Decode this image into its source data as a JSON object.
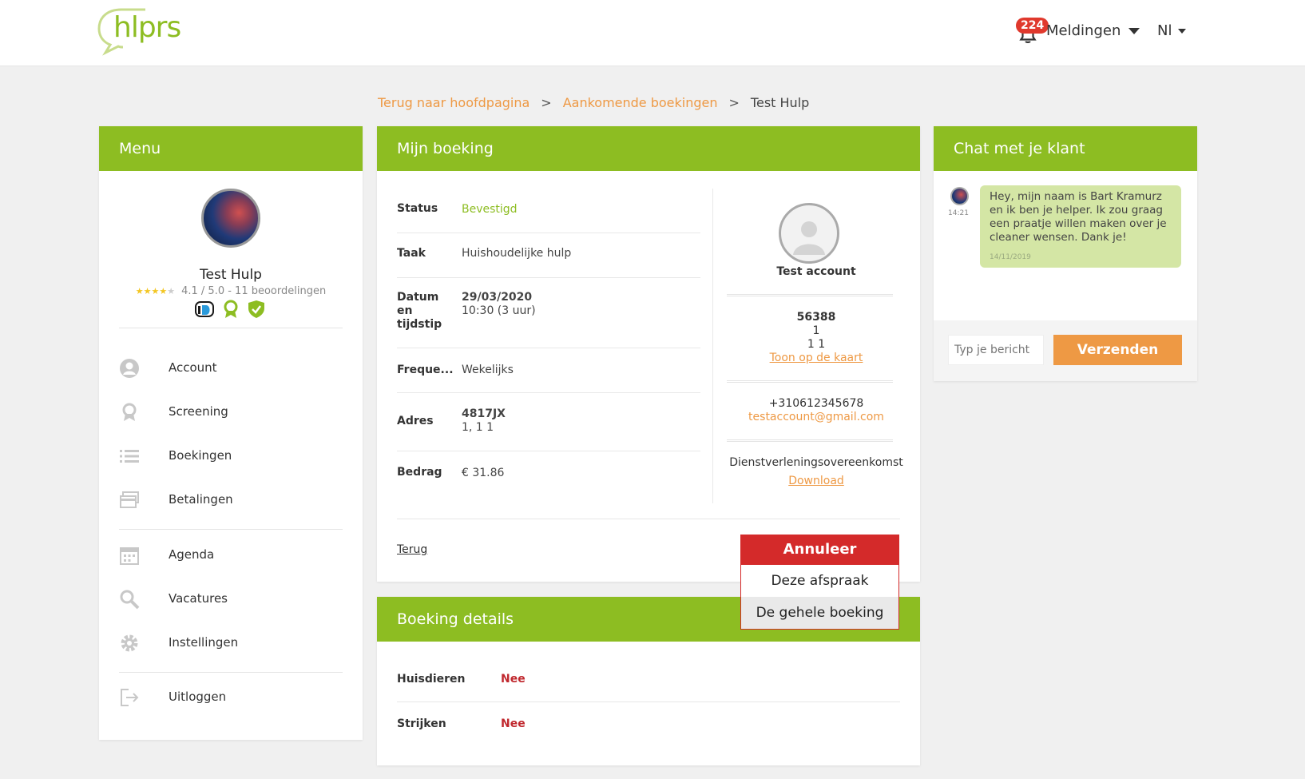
{
  "header": {
    "logo_text": "hlprs",
    "notifications": {
      "count": "224",
      "label": "Meldingen"
    },
    "language": "Nl"
  },
  "breadcrumb": {
    "home": "Terug naar hoofdpagina",
    "upcoming": "Aankomende boekingen",
    "current": "Test Hulp",
    "separator": ">"
  },
  "menu": {
    "title": "Menu",
    "profile": {
      "name": "Test Hulp",
      "rating_text": "4.1 / 5.0 - 11 beoordelingen",
      "stars": 4.1
    },
    "items": [
      {
        "label": "Account",
        "icon": "user-circle-icon"
      },
      {
        "label": "Screening",
        "icon": "award-icon"
      },
      {
        "label": "Boekingen",
        "icon": "list-icon"
      },
      {
        "label": "Betalingen",
        "icon": "credit-card-icon"
      },
      {
        "label": "Agenda",
        "icon": "calendar-icon"
      },
      {
        "label": "Vacatures",
        "icon": "search-icon"
      },
      {
        "label": "Instellingen",
        "icon": "gear-icon"
      },
      {
        "label": "Uitloggen",
        "icon": "logout-icon"
      }
    ]
  },
  "booking": {
    "title": "Mijn boeking",
    "rows": [
      {
        "key": "Status",
        "value": "Bevestigd"
      },
      {
        "key": "Taak",
        "value": "Huishoudelijke hulp"
      },
      {
        "key": "Datum en tijdstip",
        "value": "29/03/2020",
        "value2": "10:30 (3 uur)"
      },
      {
        "key": "Freque...",
        "value": "Wekelijks"
      },
      {
        "key": "Adres",
        "value": "4817JX",
        "value2": "1, 1 1"
      },
      {
        "key": "Bedrag",
        "value": "€ 31.86"
      }
    ],
    "customer": {
      "name": "Test account",
      "postcode": "56388",
      "line2": "1",
      "line3": "1 1",
      "map_link": "Toon op de kaart",
      "phone": "+310612345678",
      "email": "testaccount@gmail.com",
      "agreement": "Dienstverleningsovereenkomst",
      "download": "Download"
    },
    "back": "Terug",
    "cancel": {
      "label": "Annuleer",
      "options": [
        "Deze afspraak",
        "De gehele boeking"
      ]
    }
  },
  "details": {
    "title": "Boeking details",
    "rows": [
      {
        "key": "Huisdieren",
        "value": "Nee"
      },
      {
        "key": "Strijken",
        "value": "Nee"
      }
    ]
  },
  "chat": {
    "title": "Chat met je klant",
    "message": {
      "time": "14:21",
      "text": "Hey, mijn naam is Bart Kramurz en ik ben je helper. Ik zou graag een praatje willen maken over je cleaner wensen. Dank je!",
      "date": "14/11/2019"
    },
    "input_placeholder": "Typ je bericht",
    "send": "Verzenden"
  },
  "colors": {
    "brand_green": "#8dbd22",
    "accent_orange": "#ee9944",
    "danger_red": "#d42a2a"
  }
}
